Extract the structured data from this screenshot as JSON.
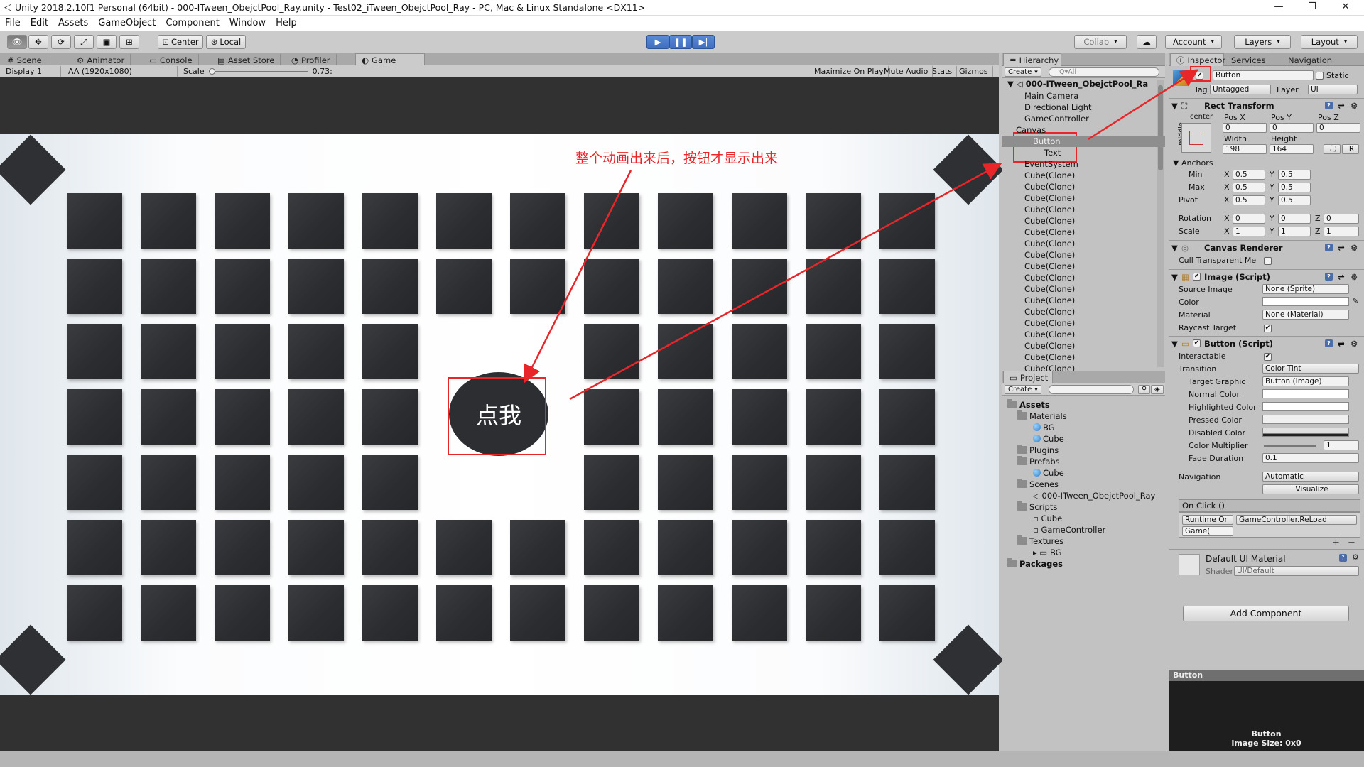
{
  "titlebar": {
    "title": "Unity 2018.2.10f1 Personal (64bit) - 000-ITween_ObejctPool_Ray.unity - Test02_iTween_ObejctPool_Ray - PC, Mac & Linux Standalone <DX11>",
    "minimize": "—",
    "maximize": "❐",
    "close": "✕"
  },
  "menu": [
    "File",
    "Edit",
    "Assets",
    "GameObject",
    "Component",
    "Window",
    "Help"
  ],
  "toolbar": {
    "center": "Center",
    "local": "Local",
    "collab": "Collab",
    "account": "Account",
    "layers": "Layers",
    "layout": "Layout",
    "cloud": "☁"
  },
  "scene_tabs": {
    "scene": "Scene",
    "animator": "Animator",
    "console": "Console",
    "asset_store": "Asset Store",
    "profiler": "Profiler",
    "game": "Game"
  },
  "game_toolbar": {
    "display": "Display 1",
    "resolution": "AA (1920x1080)",
    "scale_label": "Scale",
    "scale_value": "0.73:",
    "maximize": "Maximize On Play",
    "mute": "Mute Audio",
    "stats": "Stats",
    "gizmos": "Gizmos"
  },
  "game": {
    "button_text": "点我",
    "annotation": "整个动画出来后，按钮才显示出来",
    "grid_visibility": [
      [
        1,
        1,
        1,
        1,
        1,
        1,
        1,
        1,
        1,
        1,
        1,
        1
      ],
      [
        1,
        1,
        1,
        1,
        1,
        1,
        1,
        1,
        1,
        1,
        1,
        1
      ],
      [
        1,
        1,
        1,
        1,
        1,
        0,
        0,
        1,
        1,
        1,
        1,
        1
      ],
      [
        1,
        1,
        1,
        1,
        1,
        0,
        0,
        1,
        1,
        1,
        1,
        1
      ],
      [
        1,
        1,
        1,
        1,
        1,
        0,
        0,
        1,
        1,
        1,
        1,
        1
      ],
      [
        1,
        1,
        1,
        1,
        1,
        1,
        1,
        1,
        1,
        1,
        1,
        1
      ],
      [
        1,
        1,
        1,
        1,
        1,
        1,
        1,
        1,
        1,
        1,
        1,
        1
      ]
    ]
  },
  "hierarchy": {
    "tab": "Hierarchy",
    "create": "Create",
    "search": "Q▾All",
    "scene": "000-ITween_ObejctPool_Ra",
    "items": [
      "Main Camera",
      "Directional Light",
      "GameController",
      "Canvas",
      "Button",
      "Text",
      "EventSystem",
      "Cube(Clone)",
      "Cube(Clone)",
      "Cube(Clone)",
      "Cube(Clone)",
      "Cube(Clone)",
      "Cube(Clone)",
      "Cube(Clone)",
      "Cube(Clone)",
      "Cube(Clone)",
      "Cube(Clone)",
      "Cube(Clone)",
      "Cube(Clone)",
      "Cube(Clone)",
      "Cube(Clone)",
      "Cube(Clone)",
      "Cube(Clone)",
      "Cube(Clone)",
      "Cube(Clone)"
    ]
  },
  "project": {
    "tab": "Project",
    "create": "Create",
    "items": [
      {
        "label": "Assets",
        "kind": "folder",
        "bold": true
      },
      {
        "label": "Materials",
        "kind": "folder"
      },
      {
        "label": "BG",
        "kind": "material"
      },
      {
        "label": "Cube",
        "kind": "material"
      },
      {
        "label": "Plugins",
        "kind": "folder"
      },
      {
        "label": "Prefabs",
        "kind": "folder"
      },
      {
        "label": "Cube",
        "kind": "prefab"
      },
      {
        "label": "Scenes",
        "kind": "folder"
      },
      {
        "label": "000-ITween_ObejctPool_Ray",
        "kind": "scene"
      },
      {
        "label": "Scripts",
        "kind": "folder"
      },
      {
        "label": "Cube",
        "kind": "script"
      },
      {
        "label": "GameController",
        "kind": "script"
      },
      {
        "label": "Textures",
        "kind": "folder"
      },
      {
        "label": "BG",
        "kind": "texture"
      },
      {
        "label": "Packages",
        "kind": "folder",
        "bold": true
      }
    ]
  },
  "inspector": {
    "tabs": {
      "inspector": "Inspector",
      "services": "Services",
      "navigation": "Navigation"
    },
    "name": "Button",
    "static": "Static",
    "tag_label": "Tag",
    "tag": "Untagged",
    "layer_label": "Layer",
    "layer": "UI",
    "rect": {
      "title": "Rect Transform",
      "anchor_h": "center",
      "anchor_v": "middle",
      "posx_l": "Pos X",
      "posy_l": "Pos Y",
      "posz_l": "Pos Z",
      "posx": "0",
      "posy": "0",
      "posz": "0",
      "width_l": "Width",
      "height_l": "Height",
      "width": "198",
      "height": "164",
      "r_btn": "R",
      "anchors": "Anchors",
      "min": "Min",
      "max": "Max",
      "pivot": "Pivot",
      "ax": "0.5",
      "ay": "0.5",
      "rotation": "Rotation",
      "scale": "Scale",
      "rot": "0",
      "scl": "1",
      "x": "X",
      "y": "Y",
      "z": "Z"
    },
    "canvas_renderer": {
      "title": "Canvas Renderer",
      "cull": "Cull Transparent Me"
    },
    "image": {
      "title": "Image (Script)",
      "source_l": "Source Image",
      "source": "None (Sprite)",
      "color_l": "Color",
      "material_l": "Material",
      "material": "None (Material)",
      "raycast_l": "Raycast Target"
    },
    "button": {
      "title": "Button (Script)",
      "interactable": "Interactable",
      "transition_l": "Transition",
      "transition": "Color Tint",
      "target_l": "Target Graphic",
      "target": "Button (Image)",
      "normal": "Normal Color",
      "highlighted": "Highlighted Color",
      "pressed": "Pressed Color",
      "disabled": "Disabled Color",
      "multiplier": "Color Multiplier",
      "multiplier_v": "1",
      "fade": "Fade Duration",
      "fade_v": "0.1",
      "navigation_l": "Navigation",
      "navigation": "Automatic",
      "visualize": "Visualize",
      "onclick": "On Click ()",
      "runtime": "Runtime Or",
      "func": "GameController.ReLoad",
      "obj": "Game(",
      "plus": "+",
      "minus": "−"
    },
    "material": {
      "title": "Default UI Material",
      "shader_l": "Shader",
      "shader": "UI/Default"
    },
    "add_component": "Add Component",
    "preview": {
      "header": "Button",
      "name": "Button",
      "size": "Image Size: 0x0"
    }
  },
  "colors": {
    "accent": "#3f6fc0",
    "annotation_red": "#e8262a",
    "cube": "#2c2e32"
  }
}
